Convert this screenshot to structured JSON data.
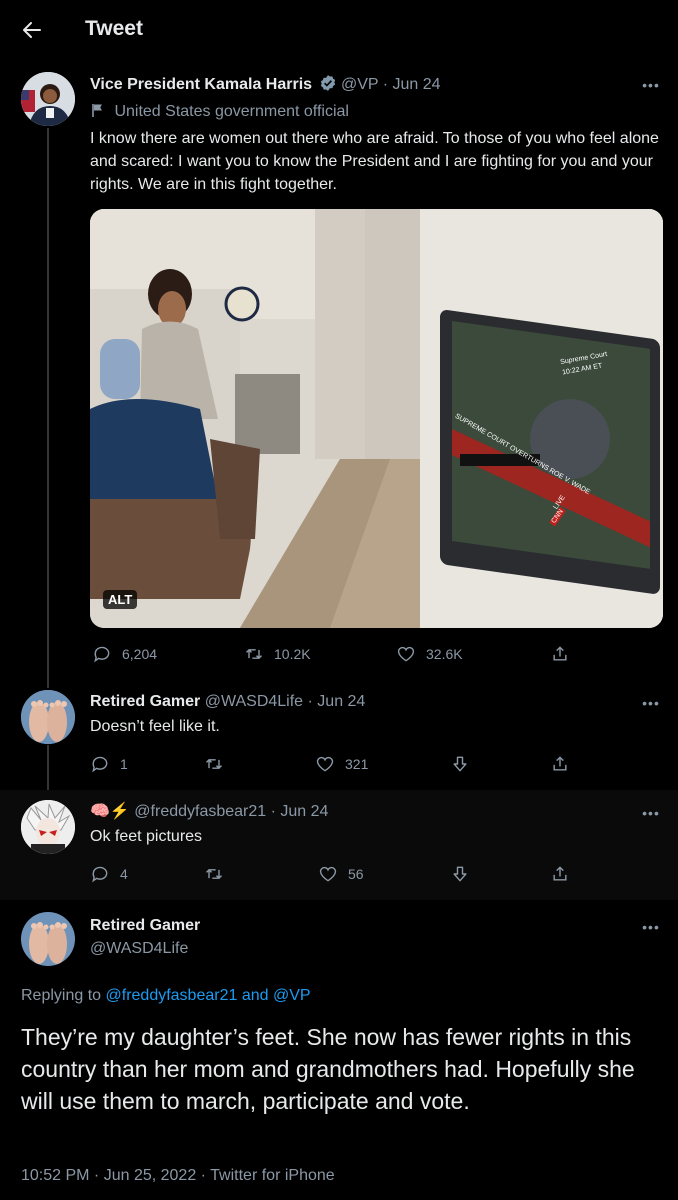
{
  "header": {
    "title": "Tweet"
  },
  "main_tweet": {
    "author_name": "Vice President Kamala Harris",
    "handle": "@VP",
    "date": "· Jun 24",
    "label": "United States government official",
    "text": "I know there are women out there who are afraid. To those of you who feel alone and scared: I want you to know the President and I are fighting for you and your rights. We are in this fight together.",
    "alt_badge": "ALT",
    "tv_text": {
      "court": "Supreme Court",
      "time": "10:22 AM ET",
      "banner": "SUPREME COURT OVERTURNS ROE V. WADE",
      "live": "LIVE",
      "network": "CNN"
    },
    "stats": {
      "replies": "6,204",
      "retweets": "10.2K",
      "likes": "32.6K"
    }
  },
  "reply1": {
    "author_name": "Retired Gamer",
    "handle": "@WASD4Life",
    "date": "· Jun 24",
    "text": "Doesn’t feel like it.",
    "stats": {
      "replies": "1",
      "retweets": "",
      "likes": "321"
    }
  },
  "reply2": {
    "emoji": "🧠⚡",
    "handle": "@freddyfasbear21",
    "date": "· Jun 24",
    "text": "Ok feet pictures",
    "stats": {
      "replies": "4",
      "retweets": "",
      "likes": "56"
    }
  },
  "focused": {
    "author_name": "Retired Gamer",
    "handle": "@WASD4Life",
    "replying_prefix": "Replying to",
    "replying_users": "@freddyfasbear21 and @VP",
    "text": "They’re my daughter’s feet. She now has fewer rights in this country than her mom and grandmothers had. Hopefully she will use them to march, participate and vote.",
    "meta": "10:52 PM · Jun 25, 2022 · Twitter for iPhone"
  },
  "colors": {
    "background": "#000000",
    "text": "#e7e9ea",
    "muted": "#8b98a5",
    "link": "#1d9bf0",
    "verified": "#829aab"
  }
}
